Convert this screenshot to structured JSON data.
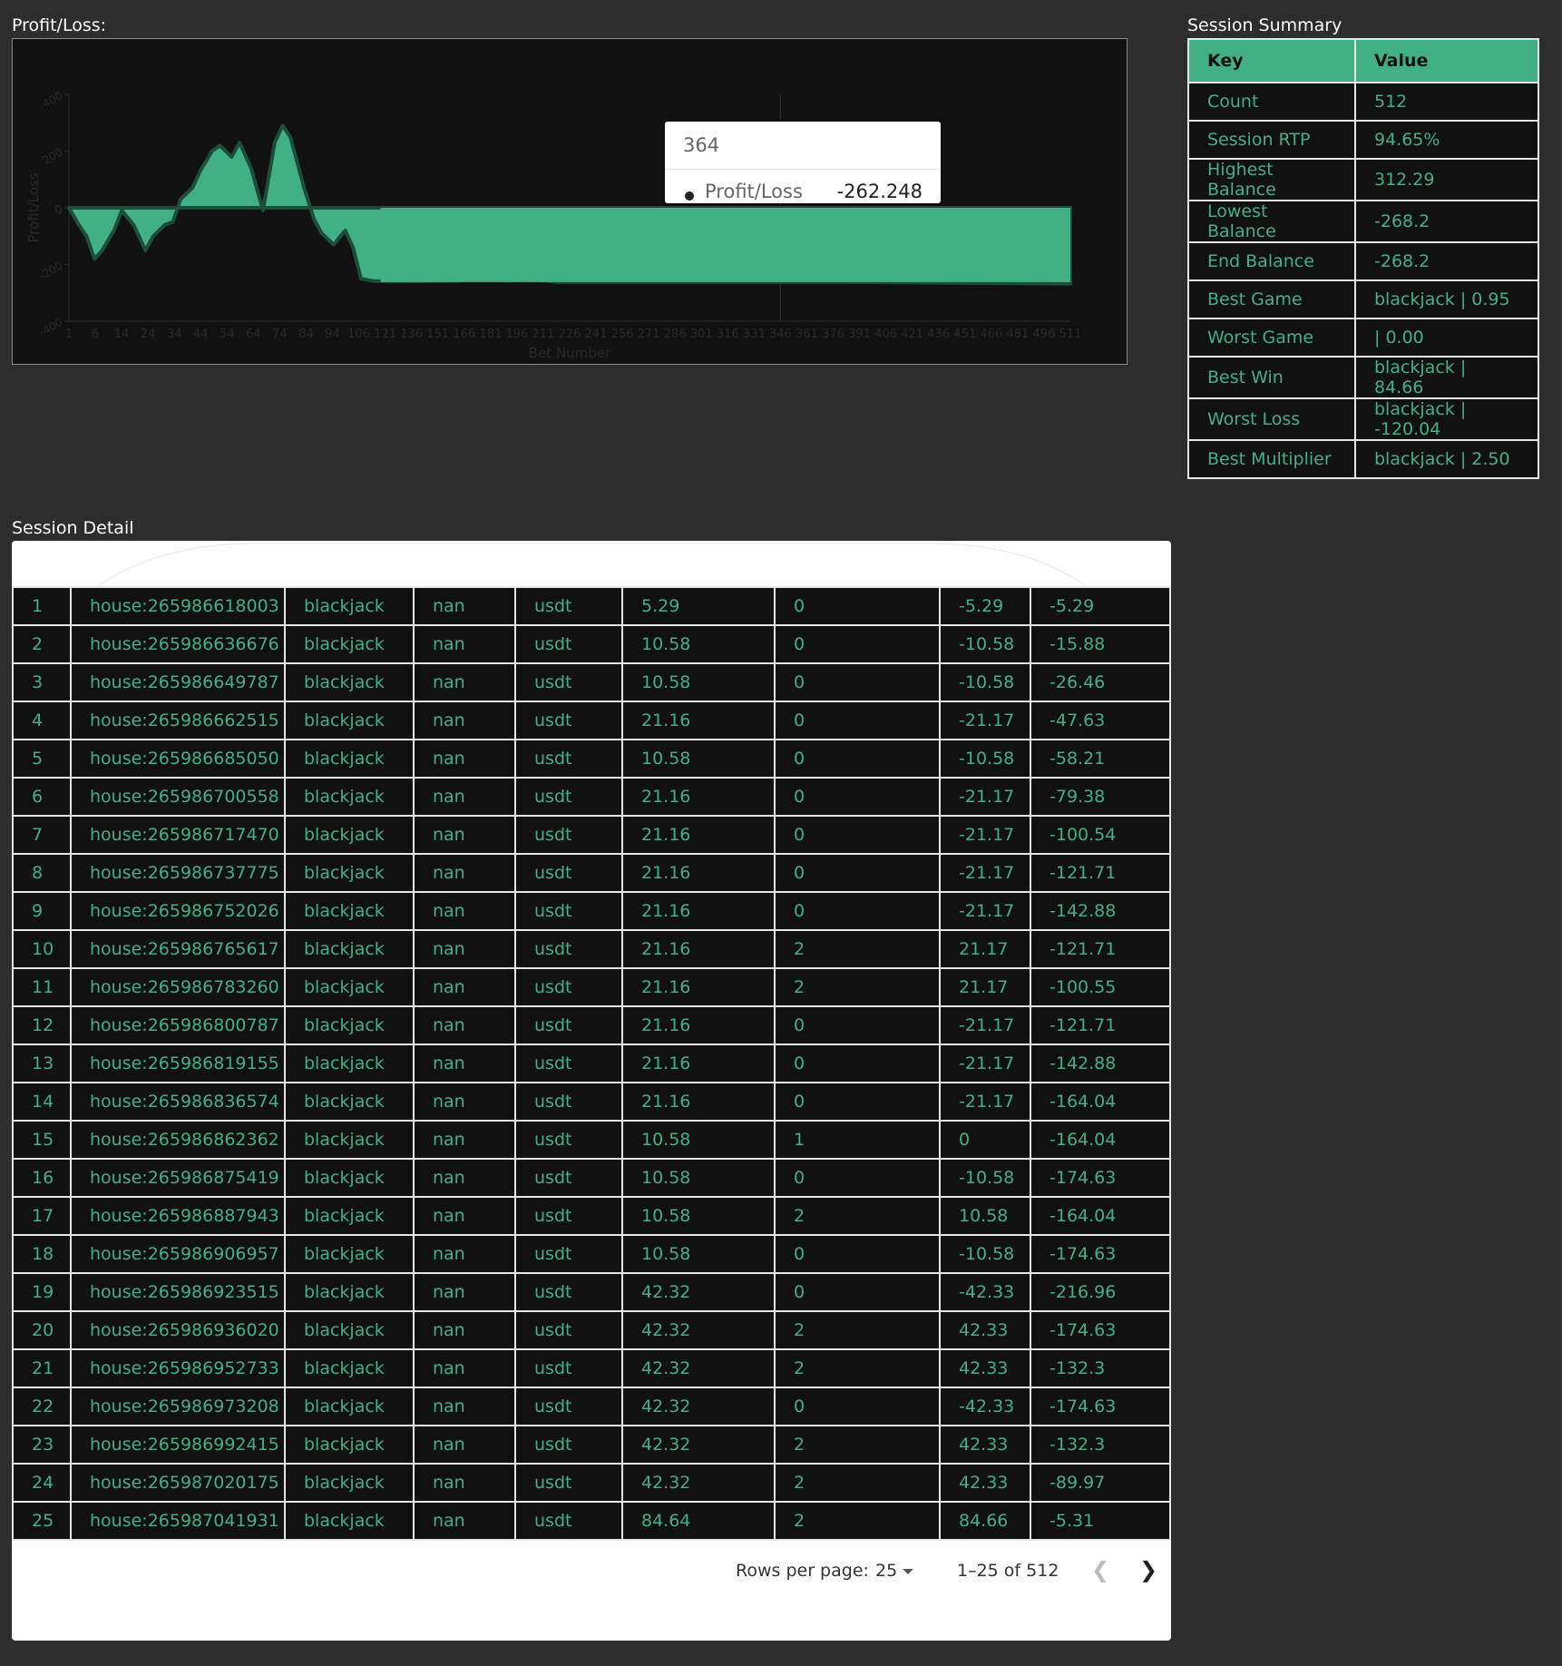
{
  "labels": {
    "chart": "Profit/Loss:",
    "summary": "Session Summary",
    "detail": "Session Detail"
  },
  "colors": {
    "accent": "#42b085",
    "background": "#2d2d2d",
    "panel": "#111111"
  },
  "tooltip": {
    "title": "364",
    "series": "Profit/Loss",
    "value": "-262.248"
  },
  "chart_data": {
    "type": "area",
    "title": "",
    "xlabel": "Bet Number",
    "ylabel": "Profit/Loss",
    "ylim": [
      -400,
      400
    ],
    "yticks": [
      400,
      200,
      0,
      -200,
      -400
    ],
    "xticks": [
      1,
      6,
      14,
      24,
      34,
      44,
      54,
      64,
      74,
      84,
      94,
      106,
      121,
      136,
      151,
      166,
      181,
      196,
      211,
      226,
      241,
      256,
      271,
      286,
      301,
      316,
      331,
      346,
      361,
      376,
      391,
      406,
      421,
      436,
      451,
      466,
      481,
      496,
      511
    ],
    "xlim": [
      1,
      512
    ],
    "series": [
      {
        "name": "Profit/Loss",
        "x": [
          1,
          6,
          10,
          14,
          18,
          24,
          28,
          34,
          40,
          44,
          50,
          54,
          58,
          64,
          68,
          74,
          78,
          84,
          88,
          94,
          100,
          106,
          110,
          114,
          121,
          126,
          130,
          136,
          142,
          146,
          150,
          156,
          166,
          200,
          211,
          220,
          226,
          232,
          241,
          250,
          300,
          400,
          512
        ],
        "y": [
          0,
          -60,
          -100,
          -180,
          -150,
          -80,
          -10,
          -60,
          -150,
          -100,
          -60,
          -50,
          30,
          70,
          130,
          200,
          220,
          180,
          230,
          140,
          -10,
          230,
          290,
          250,
          70,
          -40,
          -90,
          -130,
          -80,
          -140,
          -250,
          -258,
          -260,
          -258,
          -230,
          -252,
          -258,
          -252,
          -255,
          -262,
          -262,
          -262,
          -268
        ]
      }
    ]
  },
  "summary": {
    "headers": [
      "Key",
      "Value"
    ],
    "rows": [
      [
        "Count",
        "512"
      ],
      [
        "Session RTP",
        "94.65%"
      ],
      [
        "Highest Balance",
        "312.29"
      ],
      [
        "Lowest Balance",
        "-268.2"
      ],
      [
        "End Balance",
        "-268.2"
      ],
      [
        "Best Game",
        "blackjack | 0.95"
      ],
      [
        "Worst Game",
        "| 0.00"
      ],
      [
        "Best Win",
        "blackjack | 84.66"
      ],
      [
        "Worst Loss",
        "blackjack | -120.04"
      ],
      [
        "Best Multiplier",
        "blackjack | 2.50"
      ]
    ]
  },
  "detail": {
    "rows": [
      [
        "1",
        "house:265986618003",
        "blackjack",
        "nan",
        "usdt",
        "5.29",
        "0",
        "-5.29",
        "-5.29"
      ],
      [
        "2",
        "house:265986636676",
        "blackjack",
        "nan",
        "usdt",
        "10.58",
        "0",
        "-10.58",
        "-15.88"
      ],
      [
        "3",
        "house:265986649787",
        "blackjack",
        "nan",
        "usdt",
        "10.58",
        "0",
        "-10.58",
        "-26.46"
      ],
      [
        "4",
        "house:265986662515",
        "blackjack",
        "nan",
        "usdt",
        "21.16",
        "0",
        "-21.17",
        "-47.63"
      ],
      [
        "5",
        "house:265986685050",
        "blackjack",
        "nan",
        "usdt",
        "10.58",
        "0",
        "-10.58",
        "-58.21"
      ],
      [
        "6",
        "house:265986700558",
        "blackjack",
        "nan",
        "usdt",
        "21.16",
        "0",
        "-21.17",
        "-79.38"
      ],
      [
        "7",
        "house:265986717470",
        "blackjack",
        "nan",
        "usdt",
        "21.16",
        "0",
        "-21.17",
        "-100.54"
      ],
      [
        "8",
        "house:265986737775",
        "blackjack",
        "nan",
        "usdt",
        "21.16",
        "0",
        "-21.17",
        "-121.71"
      ],
      [
        "9",
        "house:265986752026",
        "blackjack",
        "nan",
        "usdt",
        "21.16",
        "0",
        "-21.17",
        "-142.88"
      ],
      [
        "10",
        "house:265986765617",
        "blackjack",
        "nan",
        "usdt",
        "21.16",
        "2",
        "21.17",
        "-121.71"
      ],
      [
        "11",
        "house:265986783260",
        "blackjack",
        "nan",
        "usdt",
        "21.16",
        "2",
        "21.17",
        "-100.55"
      ],
      [
        "12",
        "house:265986800787",
        "blackjack",
        "nan",
        "usdt",
        "21.16",
        "0",
        "-21.17",
        "-121.71"
      ],
      [
        "13",
        "house:265986819155",
        "blackjack",
        "nan",
        "usdt",
        "21.16",
        "0",
        "-21.17",
        "-142.88"
      ],
      [
        "14",
        "house:265986836574",
        "blackjack",
        "nan",
        "usdt",
        "21.16",
        "0",
        "-21.17",
        "-164.04"
      ],
      [
        "15",
        "house:265986862362",
        "blackjack",
        "nan",
        "usdt",
        "10.58",
        "1",
        "0",
        "-164.04"
      ],
      [
        "16",
        "house:265986875419",
        "blackjack",
        "nan",
        "usdt",
        "10.58",
        "0",
        "-10.58",
        "-174.63"
      ],
      [
        "17",
        "house:265986887943",
        "blackjack",
        "nan",
        "usdt",
        "10.58",
        "2",
        "10.58",
        "-164.04"
      ],
      [
        "18",
        "house:265986906957",
        "blackjack",
        "nan",
        "usdt",
        "10.58",
        "0",
        "-10.58",
        "-174.63"
      ],
      [
        "19",
        "house:265986923515",
        "blackjack",
        "nan",
        "usdt",
        "42.32",
        "0",
        "-42.33",
        "-216.96"
      ],
      [
        "20",
        "house:265986936020",
        "blackjack",
        "nan",
        "usdt",
        "42.32",
        "2",
        "42.33",
        "-174.63"
      ],
      [
        "21",
        "house:265986952733",
        "blackjack",
        "nan",
        "usdt",
        "42.32",
        "2",
        "42.33",
        "-132.3"
      ],
      [
        "22",
        "house:265986973208",
        "blackjack",
        "nan",
        "usdt",
        "42.32",
        "0",
        "-42.33",
        "-174.63"
      ],
      [
        "23",
        "house:265986992415",
        "blackjack",
        "nan",
        "usdt",
        "42.32",
        "2",
        "42.33",
        "-132.3"
      ],
      [
        "24",
        "house:265987020175",
        "blackjack",
        "nan",
        "usdt",
        "42.32",
        "2",
        "42.33",
        "-89.97"
      ],
      [
        "25",
        "house:265987041931",
        "blackjack",
        "nan",
        "usdt",
        "84.64",
        "2",
        "84.66",
        "-5.31"
      ]
    ]
  },
  "pagination": {
    "rows_per_page_label": "Rows per page:",
    "rows_per_page": "25",
    "range": "1–25 of 512",
    "prev_icon": "chevron-left-icon",
    "next_icon": "chevron-right-icon"
  }
}
